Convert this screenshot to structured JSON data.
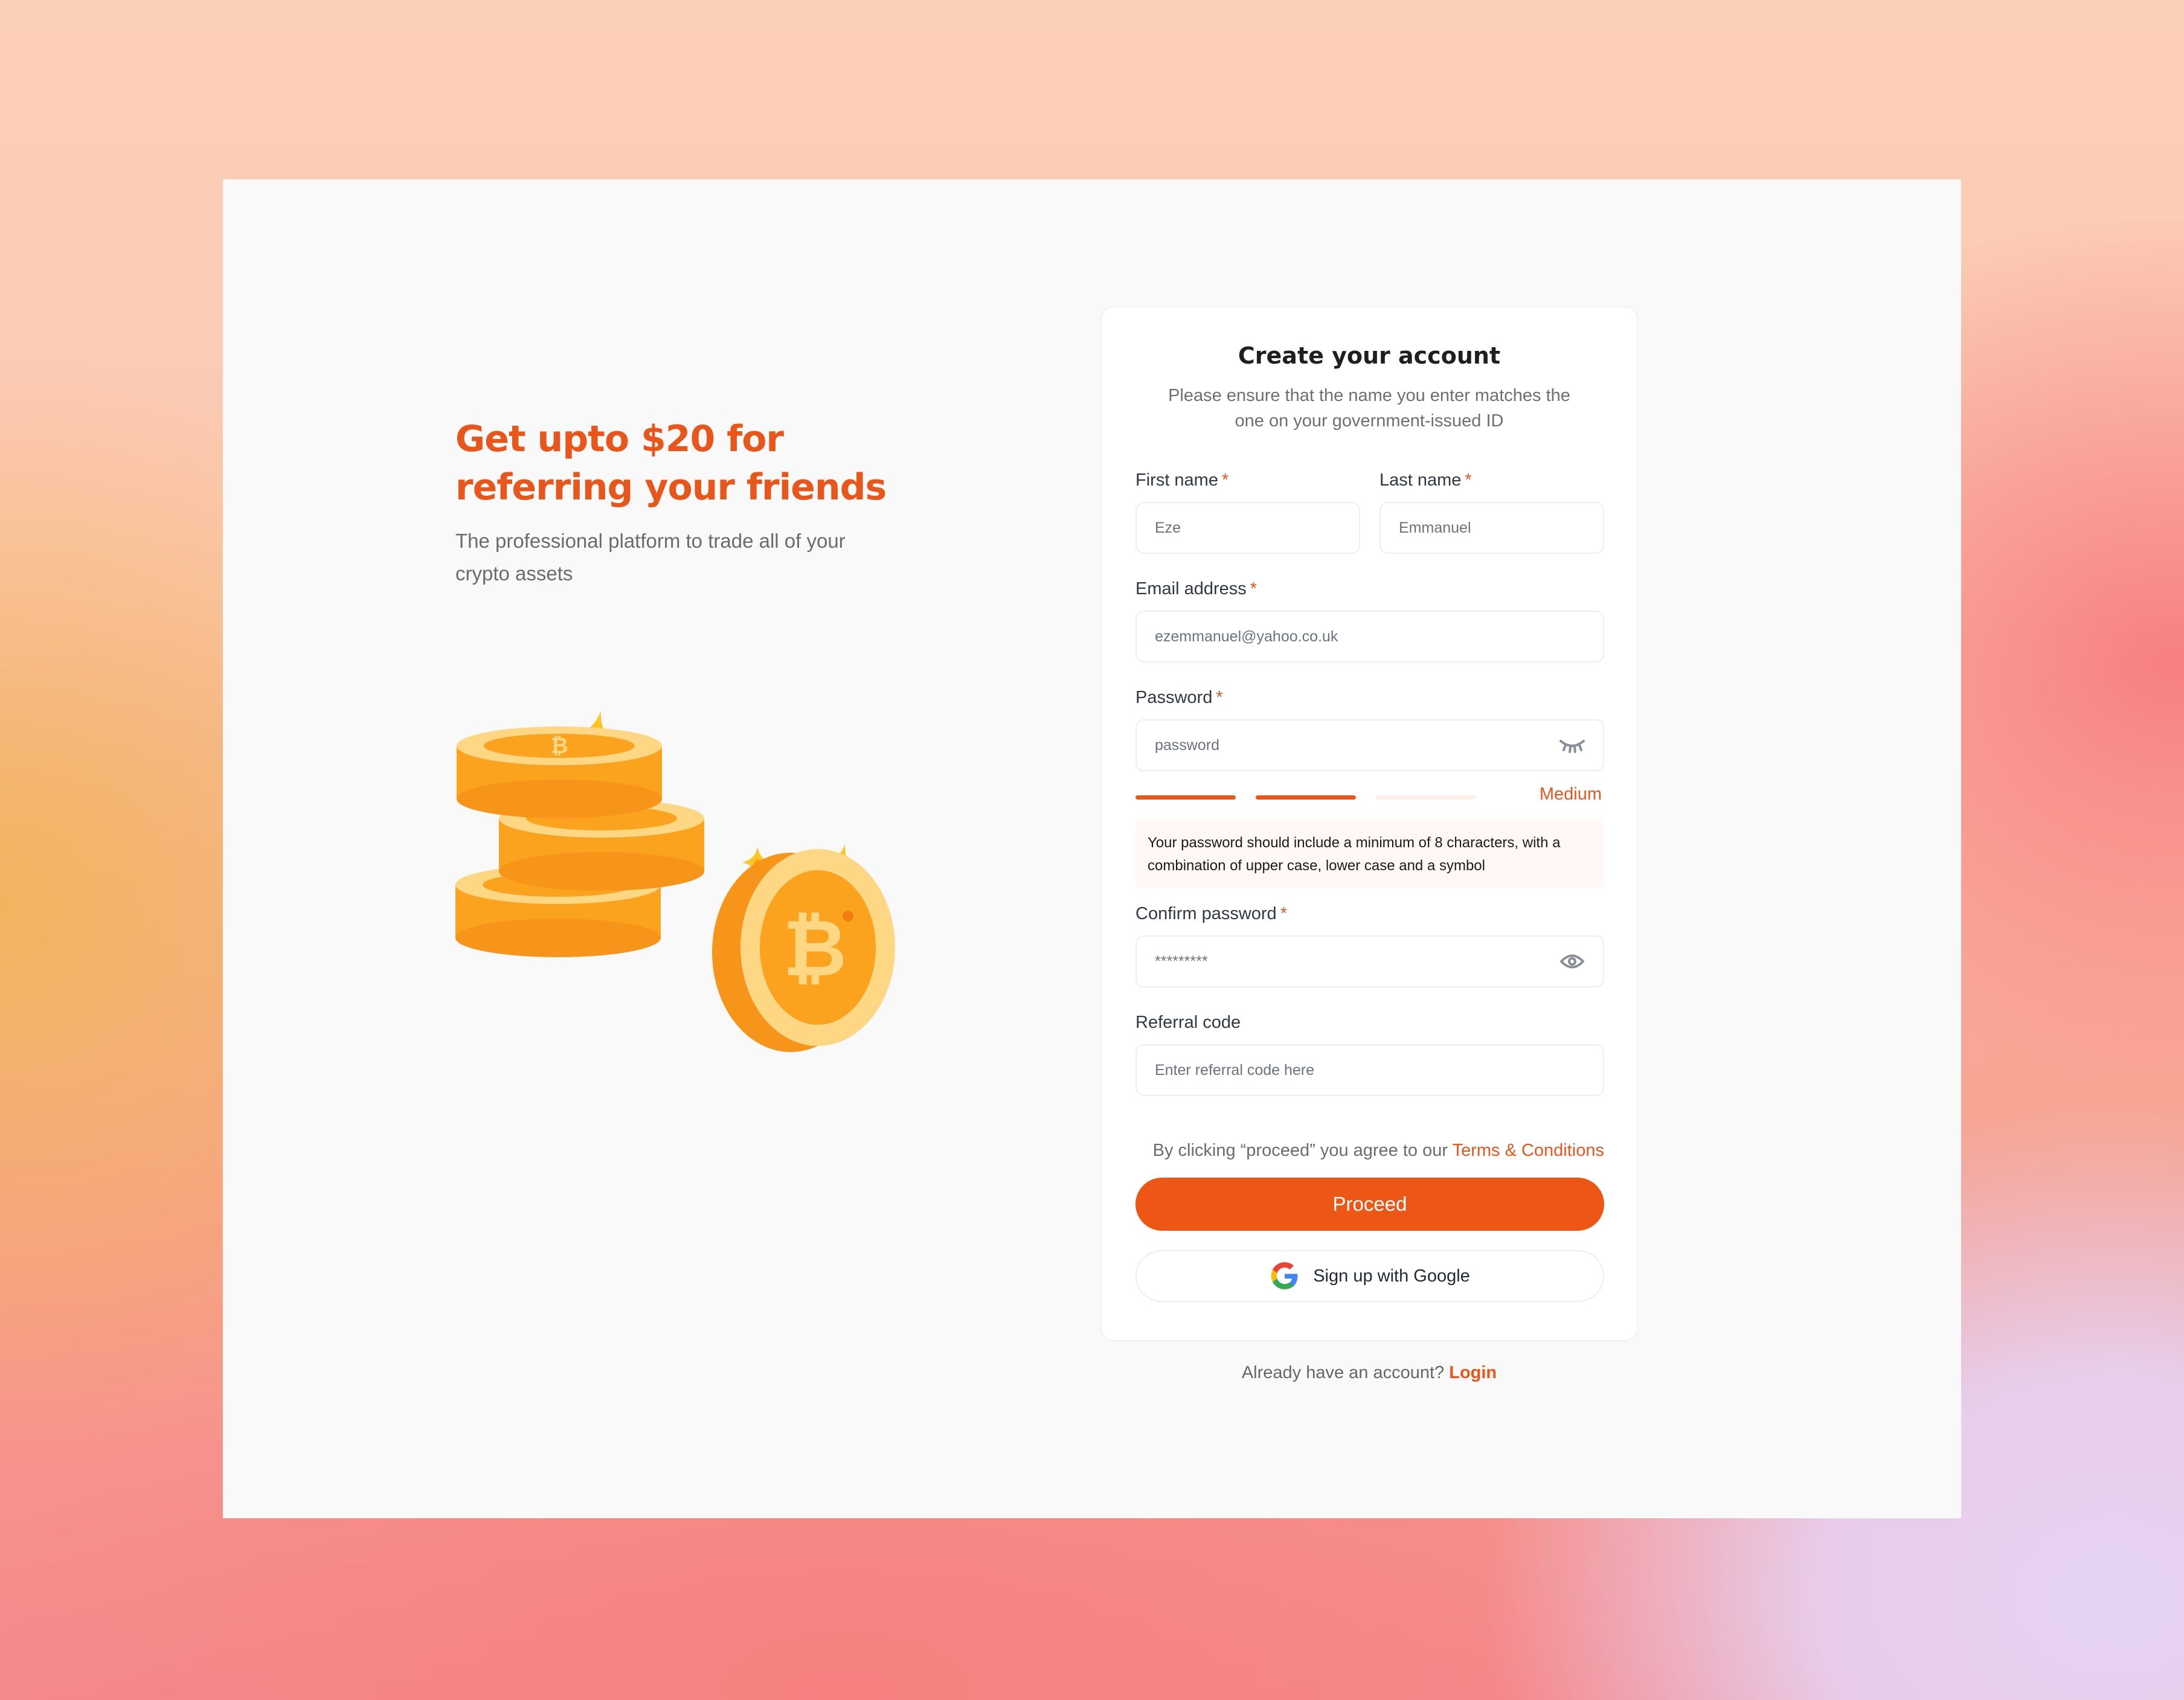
{
  "promo": {
    "headline": "Get upto $20 for referring your friends",
    "subheadline": "The professional platform to trade all of your crypto assets",
    "illustration": "bitcoin-coins-stack"
  },
  "form": {
    "title": "Create your account",
    "subtitle": "Please ensure that the name you enter matches the one on your government-issued ID",
    "required_marker": "*",
    "first_name": {
      "label": "First name",
      "value": "Eze"
    },
    "last_name": {
      "label": "Last name",
      "value": "Emmanuel"
    },
    "email": {
      "label": "Email address",
      "value": "ezemmanuel@yahoo.co.uk"
    },
    "password": {
      "label": "Password",
      "value": "password",
      "toggle_icon": "eye-closed-icon"
    },
    "strength": {
      "label": "Medium",
      "segments_total": 3,
      "segments_filled": 2
    },
    "password_hint": "Your password should include a  minimum of 8 characters, with a combination of upper case, lower case and a symbol",
    "confirm_password": {
      "label": "Confirm password",
      "value": "*********",
      "toggle_icon": "eye-open-icon"
    },
    "referral": {
      "label": "Referral code",
      "placeholder": "Enter referral code here"
    },
    "terms_prefix": "By clicking “proceed” you agree to our ",
    "terms_link": "Terms & Conditions",
    "proceed_label": "Proceed",
    "google_label": "Sign up with Google"
  },
  "footer": {
    "login_prompt": "Already have an account? ",
    "login_link": "Login"
  },
  "colors": {
    "accent": "#ee5615",
    "strength_empty": "#fdeee6",
    "hint_bg": "#fff8f4"
  }
}
